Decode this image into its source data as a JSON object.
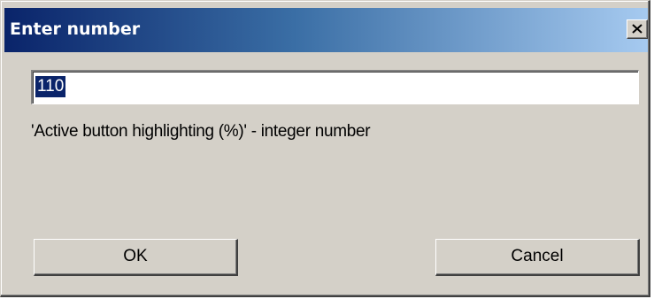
{
  "dialog": {
    "title": "Enter number",
    "close_icon": "close-icon",
    "input_value": "110",
    "prompt": "'Active button highlighting (%)' - integer number",
    "ok_label": "OK",
    "cancel_label": "Cancel"
  },
  "colors": {
    "title_gradient_start": "#0a246a",
    "title_gradient_end": "#a6caf0",
    "face": "#d4d0c8",
    "selection": "#0a246a"
  }
}
